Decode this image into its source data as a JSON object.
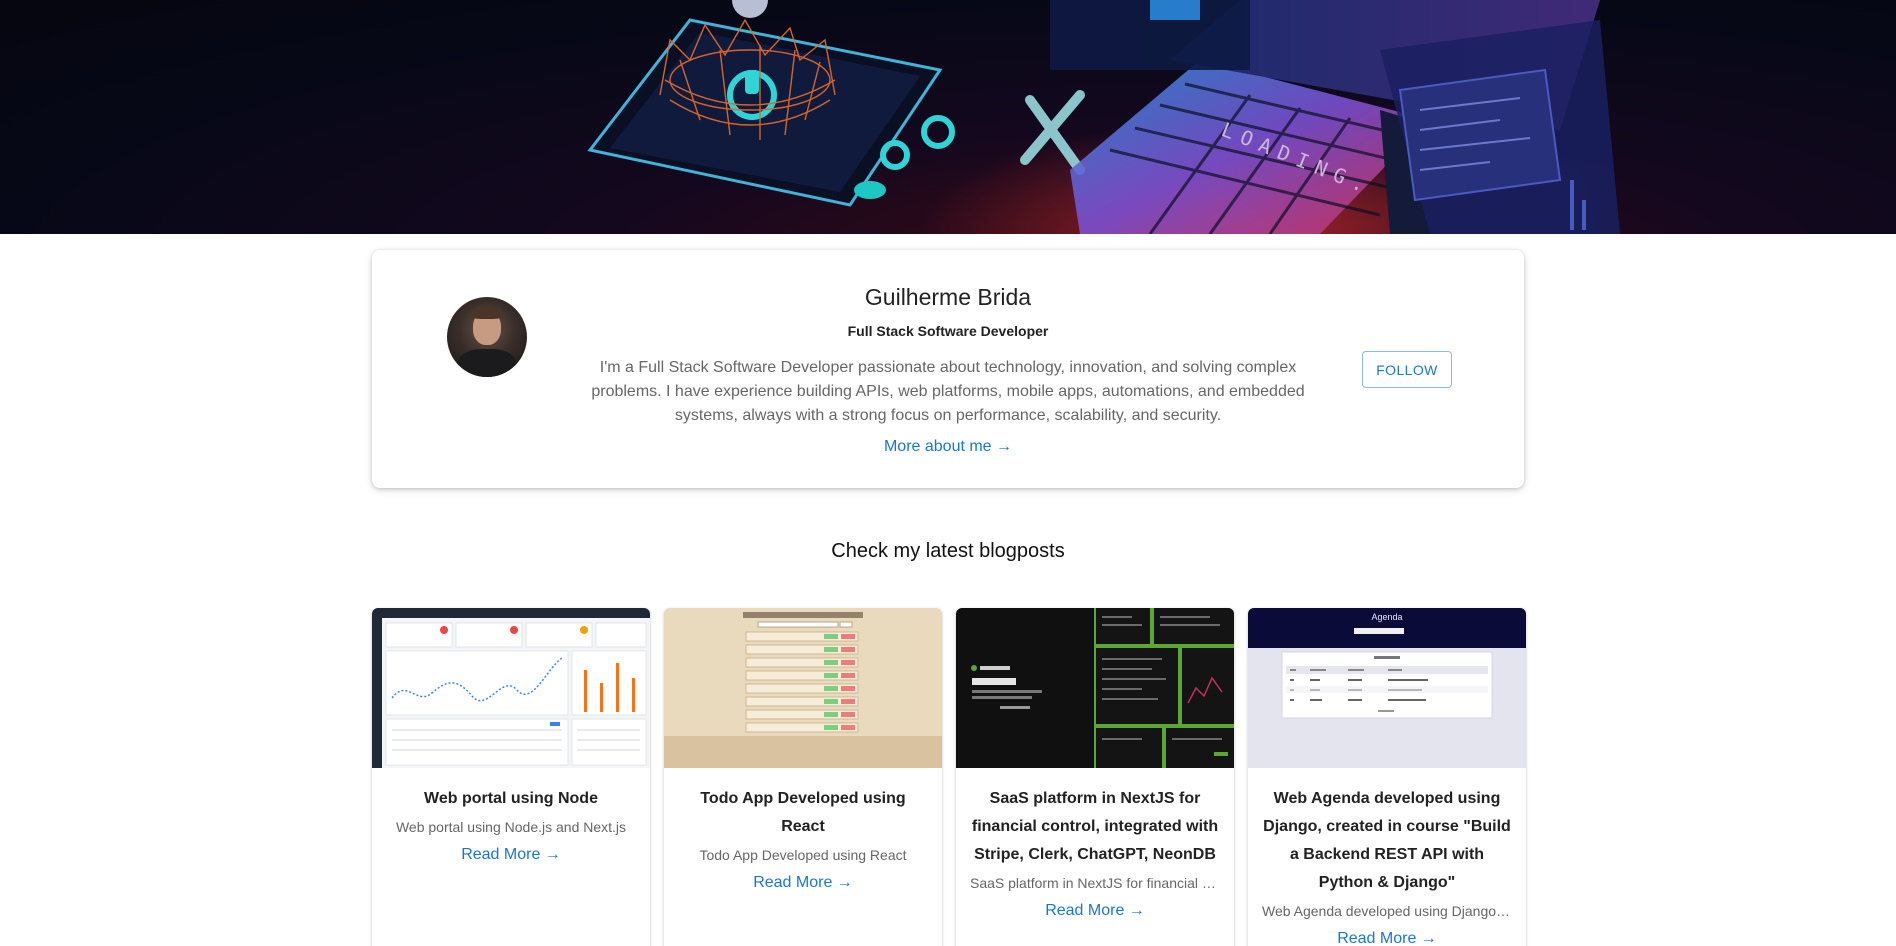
{
  "profile": {
    "name": "Guilherme Brida",
    "role": "Full Stack Software Developer",
    "bio": "I'm a Full Stack Software Developer passionate about technology, innovation, and solving complex problems. I have experience building APIs, web platforms, mobile apps, automations, and embedded systems, always with a strong focus on performance, scalability, and security.",
    "more_link": "More about me →",
    "follow_label": "FOLLOW"
  },
  "section_title": "Check my latest blogposts",
  "posts": [
    {
      "title": "Web portal using Node",
      "description": "Web portal using Node.js and Next.js",
      "read_more": "Read More →"
    },
    {
      "title": "Todo App Developed using React",
      "description": "Todo App Developed using React",
      "read_more": "Read More →"
    },
    {
      "title": "SaaS platform in NextJS for financial control, integrated with Stripe, Clerk, ChatGPT, NeonDB",
      "description": "SaaS platform in NextJS for financial control, integrated with Stripe, Clerk, ChatGPT, NeonDB",
      "read_more": "Read More →"
    },
    {
      "title": "Web Agenda developed using Django, created in course \"Build a Backend REST API with Python & Django\"",
      "description": "Web Agenda developed using Django, created in course \"Build a Backend REST API with Python & Django\"",
      "read_more": "Read More →"
    }
  ],
  "thumbnails": {
    "agenda_header": "Agenda"
  },
  "hero_text": "LOADING.",
  "colors": {
    "accent": "#1976d2",
    "hero_orange": "#e0692a",
    "hero_cyan": "#2fd4d6",
    "hero_pink": "#c2305c",
    "saas_green": "#5aa832"
  }
}
